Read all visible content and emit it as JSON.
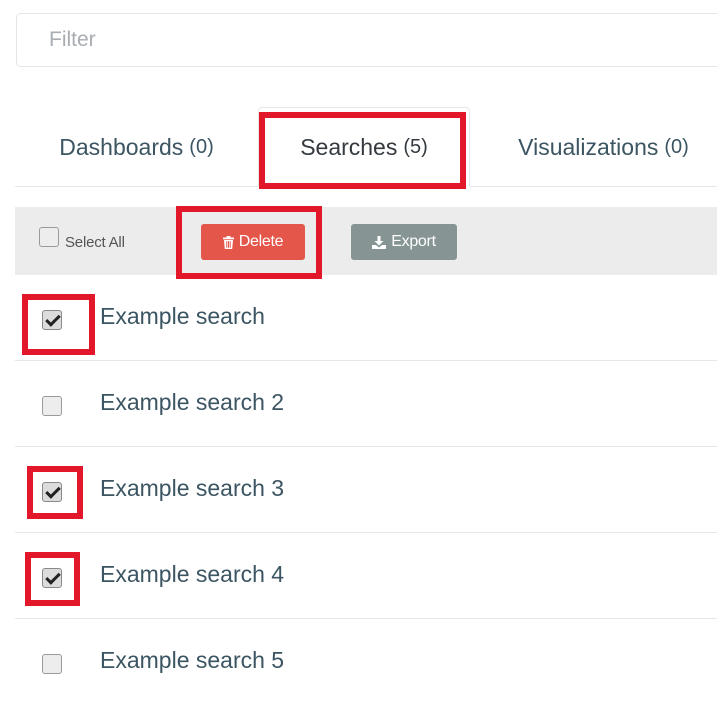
{
  "filter": {
    "placeholder": "Filter",
    "value": ""
  },
  "tabs": [
    {
      "label": "Dashboards",
      "count": "(0)",
      "active": false
    },
    {
      "label": "Searches",
      "count": "(5)",
      "active": true
    },
    {
      "label": "Visualizations",
      "count": "(0)",
      "active": false
    }
  ],
  "toolbar": {
    "select_all_label": "Select All",
    "select_all_checked": false,
    "delete_label": "Delete",
    "export_label": "Export",
    "delete_color": "#e4554a",
    "export_color": "#869494"
  },
  "items": [
    {
      "name": "Example search",
      "checked": true
    },
    {
      "name": "Example search 2",
      "checked": false
    },
    {
      "name": "Example search 3",
      "checked": true
    },
    {
      "name": "Example search 4",
      "checked": true
    },
    {
      "name": "Example search 5",
      "checked": false
    }
  ],
  "annotation_color": "#e2172a",
  "icons": {
    "delete": "trash-icon",
    "export": "download-icon"
  }
}
